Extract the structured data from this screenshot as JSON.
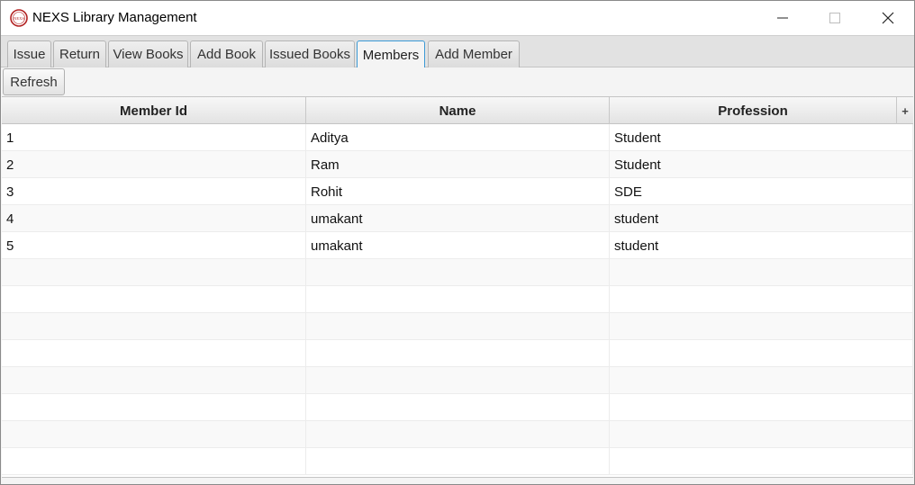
{
  "window": {
    "title": "NEXS Library Management",
    "logo_text": "NEXS"
  },
  "tabs": [
    {
      "label": "Issue",
      "active": false
    },
    {
      "label": "Return",
      "active": false
    },
    {
      "label": "View Books",
      "active": false
    },
    {
      "label": "Add Book",
      "active": false
    },
    {
      "label": "Issued Books",
      "active": false
    },
    {
      "label": "Members",
      "active": true
    },
    {
      "label": "Add Member",
      "active": false
    }
  ],
  "toolbar": {
    "refresh_label": "Refresh"
  },
  "table": {
    "columns": [
      "Member Id",
      "Name",
      "Profession"
    ],
    "corner_button": "+",
    "rows": [
      [
        "1",
        "Aditya",
        "Student"
      ],
      [
        "2",
        "Ram",
        "Student"
      ],
      [
        "3",
        "Rohit",
        "SDE"
      ],
      [
        "4",
        "umakant",
        "student"
      ],
      [
        "5",
        "umakant",
        "student"
      ]
    ],
    "empty_rows": 8
  },
  "colors": {
    "accent": "#3c9ad6",
    "logo_red": "#b22222"
  },
  "icons": {
    "minimize": "minimize-icon",
    "maximize": "maximize-icon",
    "close": "close-icon"
  }
}
